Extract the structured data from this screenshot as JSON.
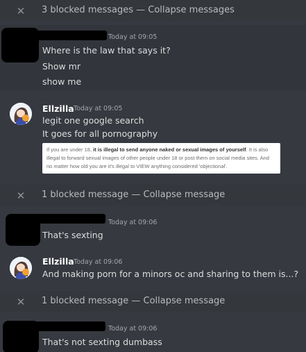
{
  "blocked_bars": [
    {
      "text": "3 blocked messages — Collapse messages"
    },
    {
      "text": "1 blocked message — Collapse message"
    },
    {
      "text": "1 blocked message — Collapse message"
    }
  ],
  "messages": [
    {
      "author": "",
      "timestamp": "Today at 09:05",
      "lines": [
        "Where is the law that says it?",
        "Show mr",
        "show me"
      ]
    },
    {
      "author": "Ellzilla",
      "timestamp": "Today at 09:05",
      "lines": [
        "legit one google search",
        "It goes for all pornography"
      ],
      "quote": {
        "before": "If you are under 18, ",
        "bold": "it is illegal to send anyone naked or sexual images of yourself",
        "after": ". It is also illegal to forward sexual images of other people under 18 or post them on social media sites. And no matter how old you are it's illegal to VIEW anything considered 'objectional'."
      }
    },
    {
      "author": "",
      "timestamp": "Today at 09:06",
      "lines": [
        "That's sexting"
      ]
    },
    {
      "author": "Ellzilla",
      "timestamp": "Today at 09:06",
      "lines": [
        "And making porn for a minors oc and sharing to them is...?"
      ]
    },
    {
      "author": "",
      "timestamp": "Today at 09:06",
      "lines": [
        "That's not sexting dumbass"
      ]
    }
  ],
  "icons": {
    "collapse": "close-icon"
  },
  "colors": {
    "background": "#36393f",
    "username": "#ffffff",
    "timestamp": "#a3a6aa",
    "text": "#dcddde"
  }
}
